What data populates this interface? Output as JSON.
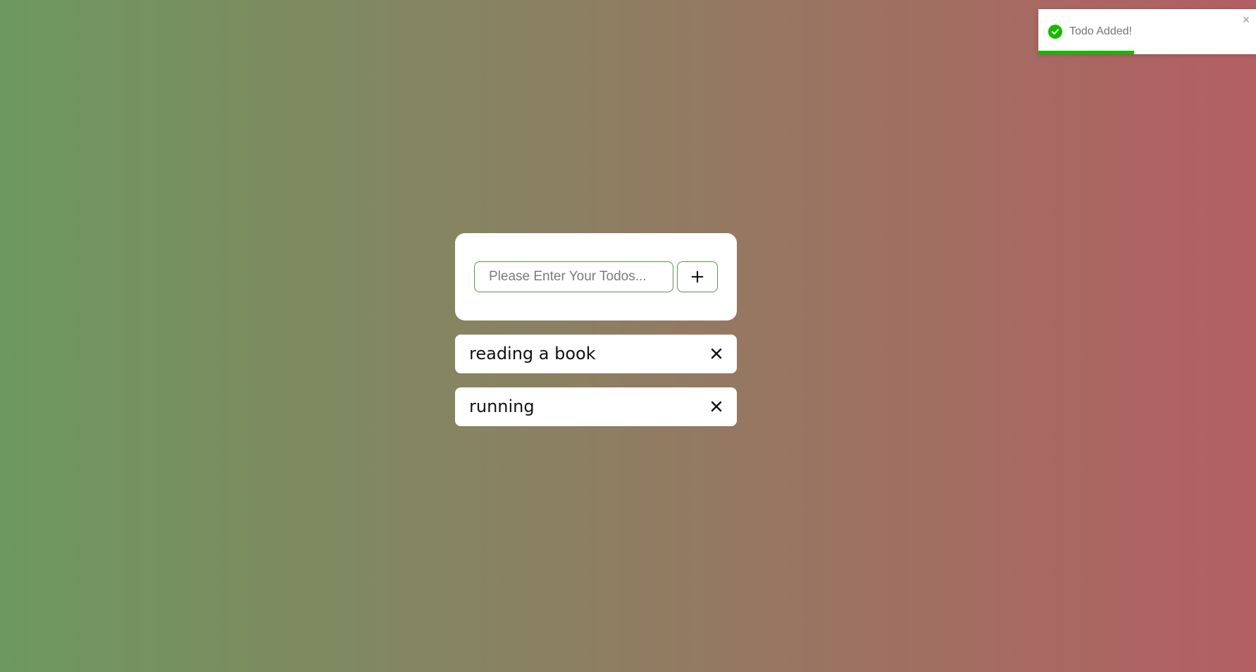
{
  "toast": {
    "message": "Todo Added!",
    "status_icon": "check-circle-icon",
    "close_glyph": "×",
    "progress": 0.44,
    "accent_color": "#16b800"
  },
  "form": {
    "input_value": "",
    "input_placeholder": "Please Enter Your Todos...",
    "add_label": "+"
  },
  "todos": [
    {
      "text": "reading a book",
      "delete_icon": "close-icon"
    },
    {
      "text": "running",
      "delete_icon": "close-icon"
    }
  ],
  "colors": {
    "gradient_start": "#6d985f",
    "gradient_mid": "#8f7d62",
    "gradient_end": "#b45f62",
    "input_border": "#5d8f52"
  }
}
